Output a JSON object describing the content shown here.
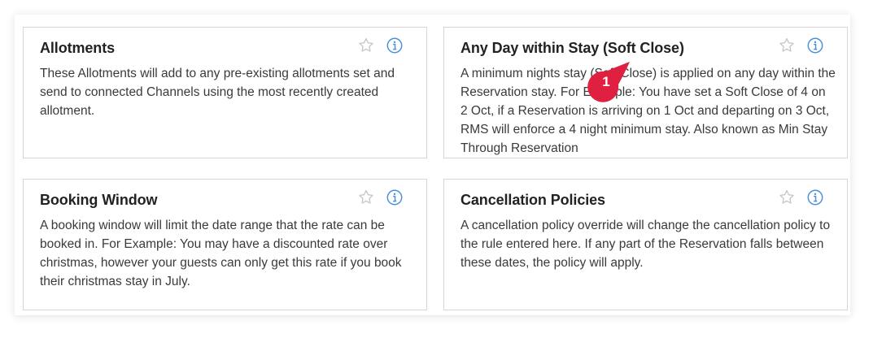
{
  "cards": [
    {
      "title": "Allotments",
      "description": "These Allotments will add to any pre-existing allotments set and send to connected Channels using the most recently created allotment."
    },
    {
      "title": "Any Day within Stay (Soft Close)",
      "description": "A minimum nights stay (Soft Close) is applied on any day within the Reservation stay. For Example: You have set a Soft Close of 4 on 2 Oct, if a Reservation is arriving on 1 Oct and departing on 3 Oct, RMS will enforce a 4 night minimum stay. Also known as Min Stay Through Reservation"
    },
    {
      "title": "Booking Window",
      "description": "A booking window will limit the date range that the rate can be booked in. For Example: You may have a discounted rate over christmas, however your guests can only get this rate if you book their christmas stay in July."
    },
    {
      "title": "Cancellation Policies",
      "description": "A cancellation policy override will change the cancellation policy to the rule entered here. If any part of the Reservation falls between these dates, the policy will apply."
    }
  ],
  "icons": {
    "favorite": "star-icon",
    "info": "info-icon"
  },
  "annotation": {
    "number": "1",
    "color": "#e02041"
  },
  "colors": {
    "icon_star": "#c8c8c8",
    "icon_info": "#4a90d9",
    "border": "#d6d6d6"
  }
}
